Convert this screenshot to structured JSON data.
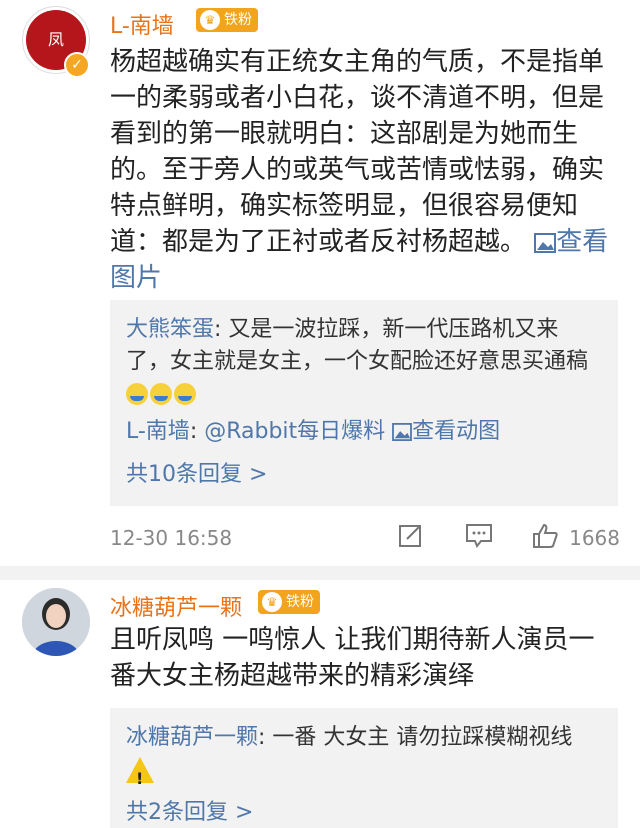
{
  "comments": [
    {
      "username": "L-南墙",
      "fan_badge": "铁粉",
      "text": "杨超越确实有正统女主角的气质，不是指单一的柔弱或者小白花，谈不清道不明，但是看到的第一眼就明白：这部剧是为她而生的。至于旁人的或英气或苦情或怯弱，确实特点鲜明，确实标签明显，但很容易便知道：都是为了正衬或者反衬杨超越。",
      "link_label": "查看图片",
      "replies": [
        {
          "user": "大熊笨蛋",
          "text": "又是一波拉踩，新一代压路机又来了，女主就是女主，一个女配脸还好意思买通稿"
        },
        {
          "user": "L-南墙",
          "mention": "@Rabbit每日爆料",
          "link_label": "查看动图"
        }
      ],
      "more_replies": "共10条回复 >",
      "timestamp": "12-30 16:58",
      "like_count": "1668"
    },
    {
      "username": "冰糖葫芦一颗",
      "fan_badge": "铁粉",
      "text": "且听凤鸣 一鸣惊人 让我们期待新人演员一番大女主杨超越带来的精彩演绎",
      "replies": [
        {
          "user": "冰糖葫芦一颗",
          "text": "一番 大女主 请勿拉踩模糊视线"
        }
      ],
      "more_replies": "共2条回复 >"
    }
  ],
  "icons": [
    "verified-icon",
    "crown-icon",
    "repost-icon",
    "comment-icon",
    "like-icon",
    "warning-icon",
    "image-icon"
  ],
  "colors": {
    "username": "#e8731b",
    "link": "#5077aa",
    "badge": "#f2a41c"
  }
}
